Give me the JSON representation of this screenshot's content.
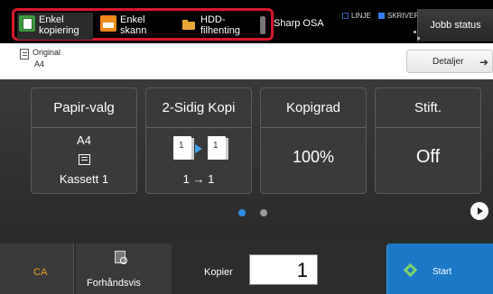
{
  "mode_tabs": [
    {
      "line1": "Enkel",
      "line2": "kopiering"
    },
    {
      "line1": "Enkel",
      "line2": "skann"
    },
    {
      "line1": "HDD-",
      "line2": "filhenting"
    }
  ],
  "header": {
    "sharp_osa": "Sharp OSA",
    "status_linje": "LINJE",
    "status_skriver": "SKRIVER",
    "job_status": "Jobb status"
  },
  "original": {
    "label": "Original",
    "value": "A4"
  },
  "details_button": "Detaljer",
  "cards": {
    "paper": {
      "title": "Papir-valg",
      "size": "A4",
      "tray": "Kassett 1"
    },
    "duplex": {
      "title": "2-Sidig Kopi",
      "page1": "1",
      "page2": "1",
      "mode": "1 → 1"
    },
    "zoom": {
      "title": "Kopigrad",
      "value": "100%"
    },
    "staple": {
      "title": "Stift.",
      "value": "Off"
    }
  },
  "pager": {
    "pages": 2,
    "current": 1
  },
  "bottom": {
    "ca": "CA",
    "preview": "Forhåndsvis",
    "copies_label": "Kopier",
    "copies_value": "1",
    "start": "Start"
  },
  "colors": {
    "highlight": "#d8182e",
    "copy_icon": "#3c9a3c",
    "scan_icon": "#f08a1a",
    "hdd_icon": "#e8a736",
    "start_button": "#1c79c7",
    "ca_text": "#f0a020",
    "page_active": "#2f8de4"
  },
  "icons": [
    "copy-icon",
    "scan-icon",
    "hdd-icon",
    "original-doc-icon",
    "arrow-right-icon",
    "tray-icon",
    "duplex-pages-icon",
    "next-page-icon",
    "preview-icon",
    "start-icon"
  ]
}
